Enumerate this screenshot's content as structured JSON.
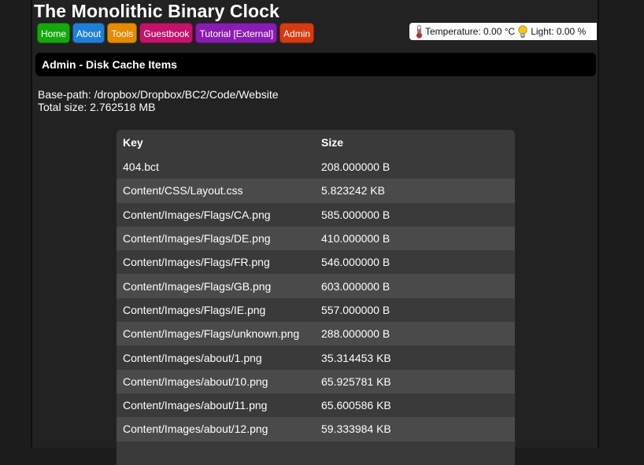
{
  "site": {
    "title": "The Monolithic Binary Clock"
  },
  "nav": [
    {
      "label": "Home",
      "color": "#13a80e"
    },
    {
      "label": "About",
      "color": "#1f7fd6"
    },
    {
      "label": "Tools",
      "color": "#e68a00"
    },
    {
      "label": "Guestbook",
      "color": "#c4126a"
    },
    {
      "label": "Tutorial [External]",
      "color": "#8a1bb3"
    },
    {
      "label": "Admin",
      "color": "#d63a10"
    }
  ],
  "status": {
    "temperature_text": "Temperature: 0.00 °C",
    "light_text": "Light: 0.00 %",
    "thermometer_icon": "thermometer-icon",
    "bulb_icon": "lightbulb-icon"
  },
  "section": {
    "title": "Admin - Disk Cache Items"
  },
  "info": {
    "base_path": "Base-path: /dropbox/Dropbox/BC2/Code/Website",
    "total_size": "Total size: 2.762518 MB"
  },
  "table": {
    "headers": {
      "key": "Key",
      "size": "Size"
    },
    "rows": [
      {
        "key": "404.bct",
        "size": "208.000000 B"
      },
      {
        "key": "Content/CSS/Layout.css",
        "size": "5.823242 KB"
      },
      {
        "key": "Content/Images/Flags/CA.png",
        "size": "585.000000 B"
      },
      {
        "key": "Content/Images/Flags/DE.png",
        "size": "410.000000 B"
      },
      {
        "key": "Content/Images/Flags/FR.png",
        "size": "546.000000 B"
      },
      {
        "key": "Content/Images/Flags/GB.png",
        "size": "603.000000 B"
      },
      {
        "key": "Content/Images/Flags/IE.png",
        "size": "557.000000 B"
      },
      {
        "key": "Content/Images/Flags/unknown.png",
        "size": "288.000000 B"
      },
      {
        "key": "Content/Images/about/1.png",
        "size": "35.314453 KB"
      },
      {
        "key": "Content/Images/about/10.png",
        "size": "65.925781 KB"
      },
      {
        "key": "Content/Images/about/11.png",
        "size": "65.600586 KB"
      },
      {
        "key": "Content/Images/about/12.png",
        "size": "59.333984 KB"
      },
      {
        "key": "",
        "size": ""
      }
    ]
  }
}
